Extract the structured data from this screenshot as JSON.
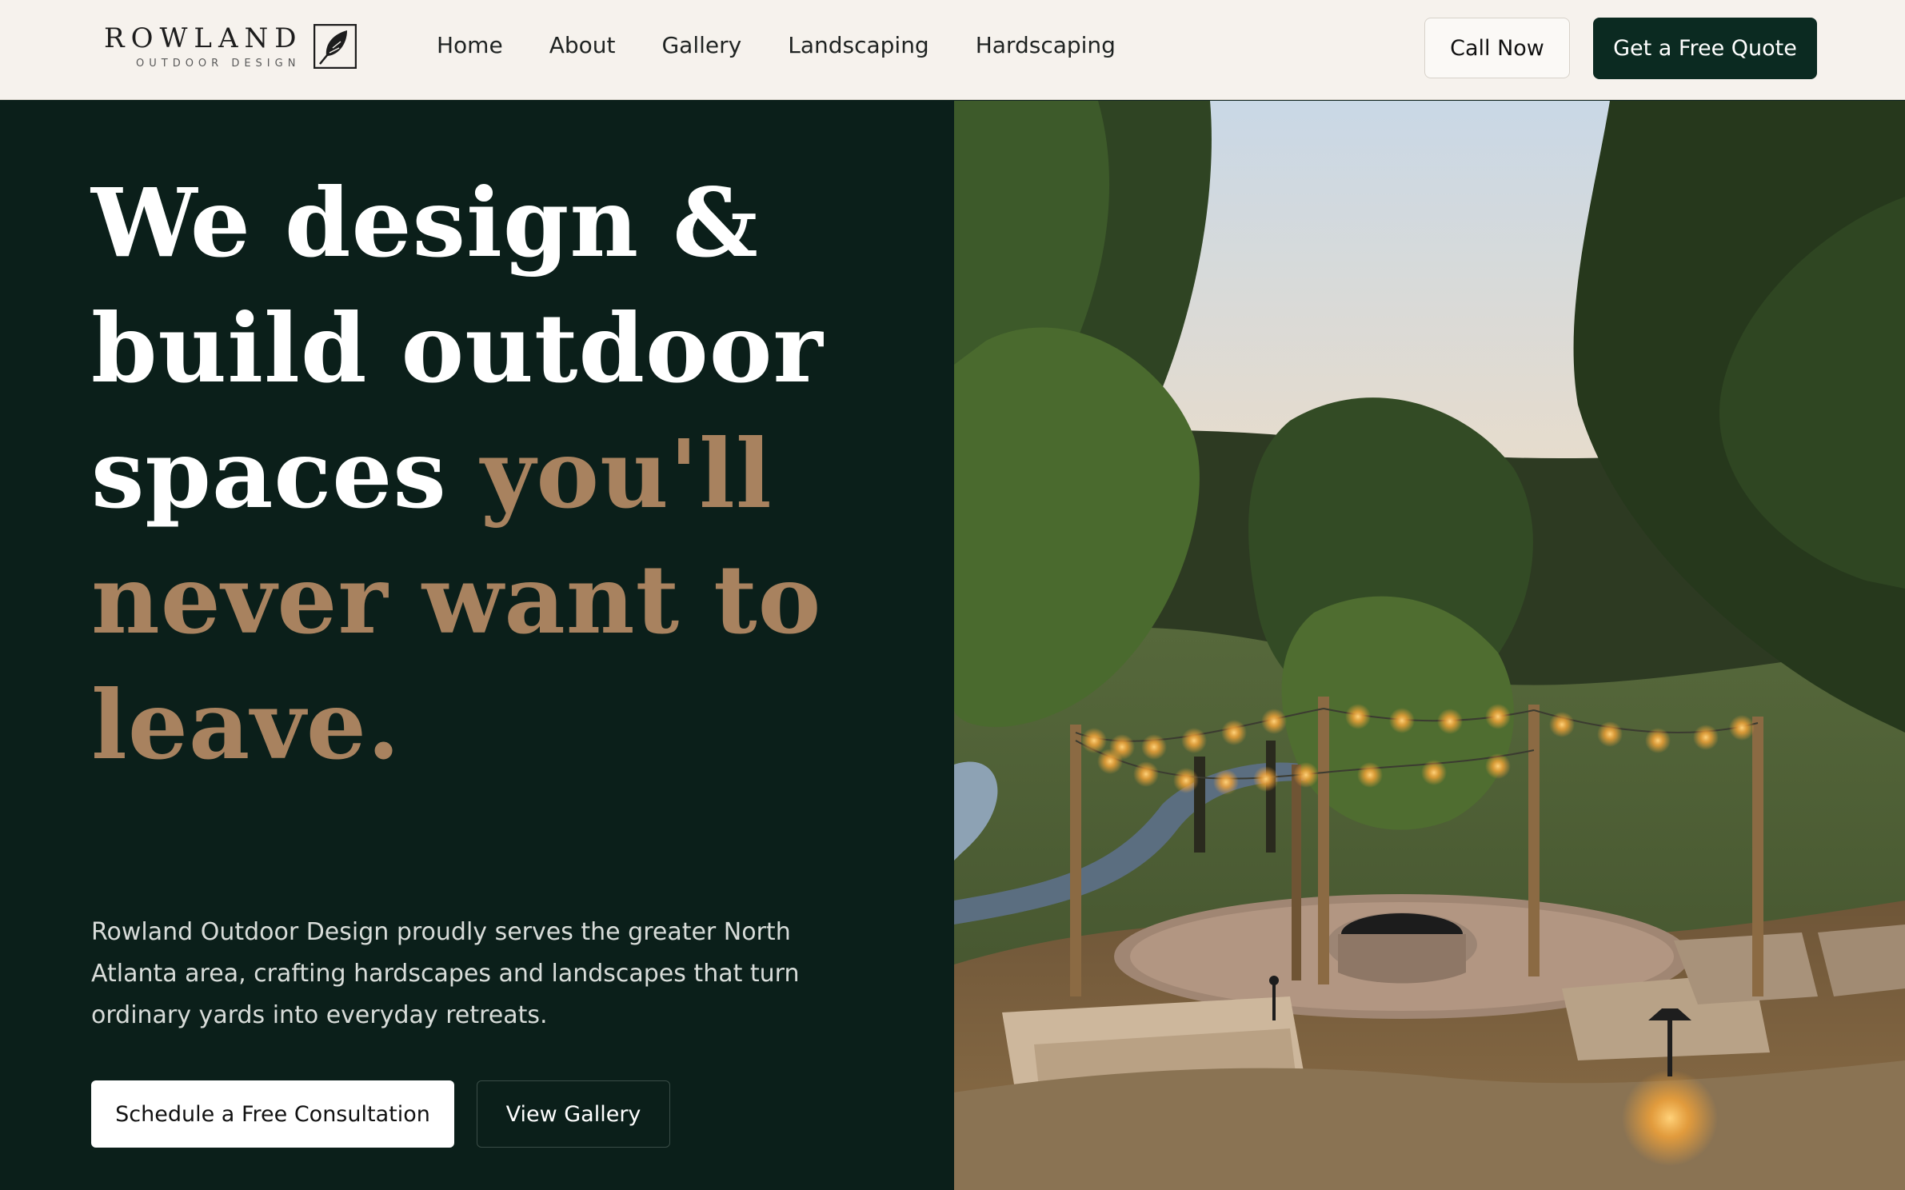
{
  "header": {
    "logo": {
      "name": "ROWLAND",
      "tagline": "OUTDOOR DESIGN"
    },
    "nav": [
      {
        "label": "Home"
      },
      {
        "label": "About"
      },
      {
        "label": "Gallery"
      },
      {
        "label": "Landscaping"
      },
      {
        "label": "Hardscaping"
      }
    ],
    "call_label": "Call Now",
    "quote_label": "Get a Free Quote"
  },
  "hero": {
    "headline_lines": [
      {
        "white": "We design &",
        "accent": ""
      },
      {
        "white": "build outdoor",
        "accent": ""
      },
      {
        "white": "spaces ",
        "accent": "you'll"
      },
      {
        "white": "",
        "accent": "never want to"
      },
      {
        "white": "",
        "accent": "leave."
      }
    ],
    "lead": "Rowland Outdoor Design proudly serves the greater North Atlanta area, crafting hardscapes and landscapes that turn ordinary yards into everyday retreats.",
    "primary_cta": "Schedule a Free Consultation",
    "secondary_cta": "View Gallery"
  },
  "colors": {
    "cream": "#f6f2ed",
    "forest": "#0b1f1a",
    "button_dark": "#0b2a21",
    "accent": "#a8825f"
  },
  "icons": {
    "logo_mark": "leaf-icon"
  }
}
